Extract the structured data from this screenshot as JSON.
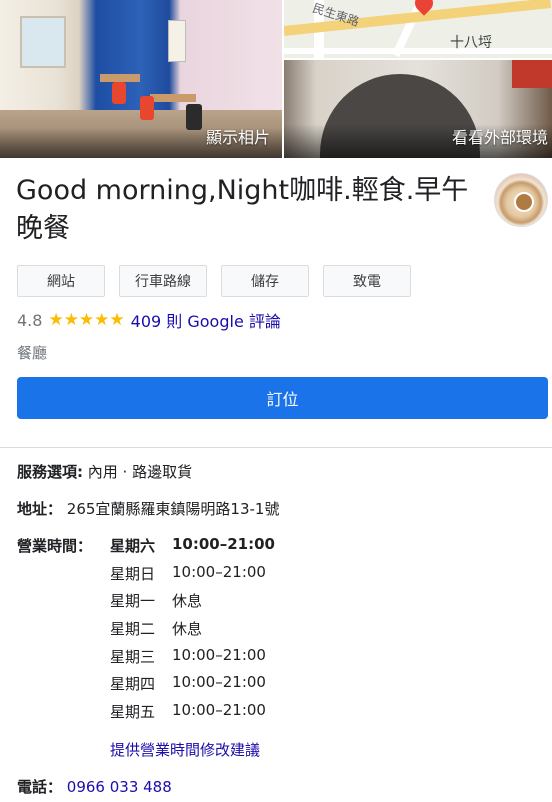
{
  "photos": {
    "main_label": "顯示相片",
    "exterior_label": "看看外部環境",
    "map": {
      "street_label": "民生東路",
      "place_label": "十八埒"
    }
  },
  "business": {
    "name": "Good morning,Night咖啡.輕食.早午晚餐",
    "rating": "4.8",
    "stars": "★★★★★",
    "reviews_text": "409 則 Google 評論",
    "category": "餐廳"
  },
  "actions": [
    {
      "label": "網站",
      "icon": "globe-icon"
    },
    {
      "label": "行車路線",
      "icon": "directions-icon"
    },
    {
      "label": "儲存",
      "icon": "bookmark-icon"
    },
    {
      "label": "致電",
      "icon": "phone-icon"
    }
  ],
  "reserve_label": "訂位",
  "info": {
    "options_label": "服務選項:",
    "options_value": "內用 · 路邊取貨",
    "address_label": "地址：",
    "address_value": "265宜蘭縣羅東鎮陽明路13-1號",
    "hours_label": "營業時間：",
    "hours": [
      {
        "day": "星期六",
        "time": "10:00–21:00",
        "today": true
      },
      {
        "day": "星期日",
        "time": "10:00–21:00",
        "today": false
      },
      {
        "day": "星期一",
        "time": "休息",
        "today": false
      },
      {
        "day": "星期二",
        "time": "休息",
        "today": false
      },
      {
        "day": "星期三",
        "time": "10:00–21:00",
        "today": false
      },
      {
        "day": "星期四",
        "time": "10:00–21:00",
        "today": false
      },
      {
        "day": "星期五",
        "time": "10:00–21:00",
        "today": false
      }
    ],
    "suggest_edit": "提供營業時間修改建議",
    "phone_label": "電話：",
    "phone_value": "0966 033 488"
  },
  "colors": {
    "accent": "#1a73e8",
    "link": "#1a0dab",
    "star": "#fbbc04"
  }
}
